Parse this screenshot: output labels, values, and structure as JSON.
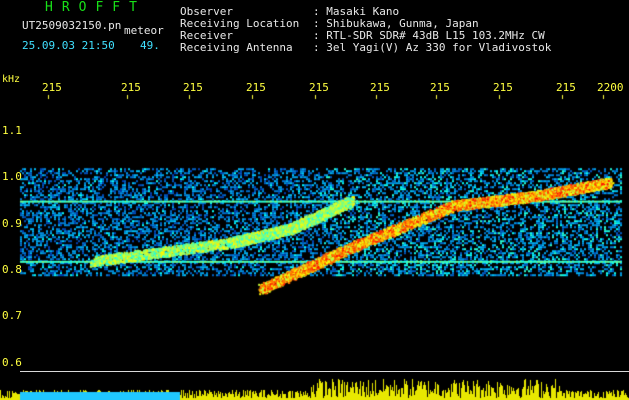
{
  "app": {
    "logo": "HROFFT",
    "file_name": "UT2509032150.pn",
    "file_type": "meteor",
    "timestamp": "25.09.03 21:50",
    "meteor_count": "49."
  },
  "station": {
    "labels": [
      "Observer",
      "Receiving Location",
      "Receiver",
      "Receiving Antenna"
    ],
    "values": [
      ": Masaki Kano",
      ": Shibukawa, Gunma, Japan",
      ": RTL-SDR SDR# 43dB L15 103.2MHz CW",
      ": 3el Yagi(V) Az 330 for Vladivostok"
    ]
  },
  "chart_data": {
    "type": "heatmap",
    "ylabel": "kHz",
    "y_ticks": [
      "1.1",
      "1.0",
      "0.9",
      "0.8",
      "0.7",
      "0.6"
    ],
    "x_ticks": [
      "215",
      "215",
      "215",
      "215",
      "215",
      "215",
      "215",
      "215",
      "215",
      "2200"
    ],
    "ylim": [
      0.58,
      1.15
    ],
    "traces": [
      {
        "name": "",
        "points": [
          [
            0.12,
            0.82
          ],
          [
            0.35,
            0.86
          ],
          [
            0.45,
            0.89
          ],
          [
            0.55,
            0.95
          ]
        ]
      },
      {
        "name": "",
        "points": [
          [
            0.4,
            0.76
          ],
          [
            0.55,
            0.85
          ],
          [
            0.72,
            0.94
          ],
          [
            0.85,
            0.96
          ],
          [
            0.98,
            0.99
          ]
        ]
      }
    ],
    "horizontal_lines_khz": [
      0.95,
      0.82
    ]
  },
  "colors": {
    "logo": "#18e018",
    "timestamp": "#40e0ff",
    "axis_text": "#ffff40",
    "background": "#000000"
  }
}
